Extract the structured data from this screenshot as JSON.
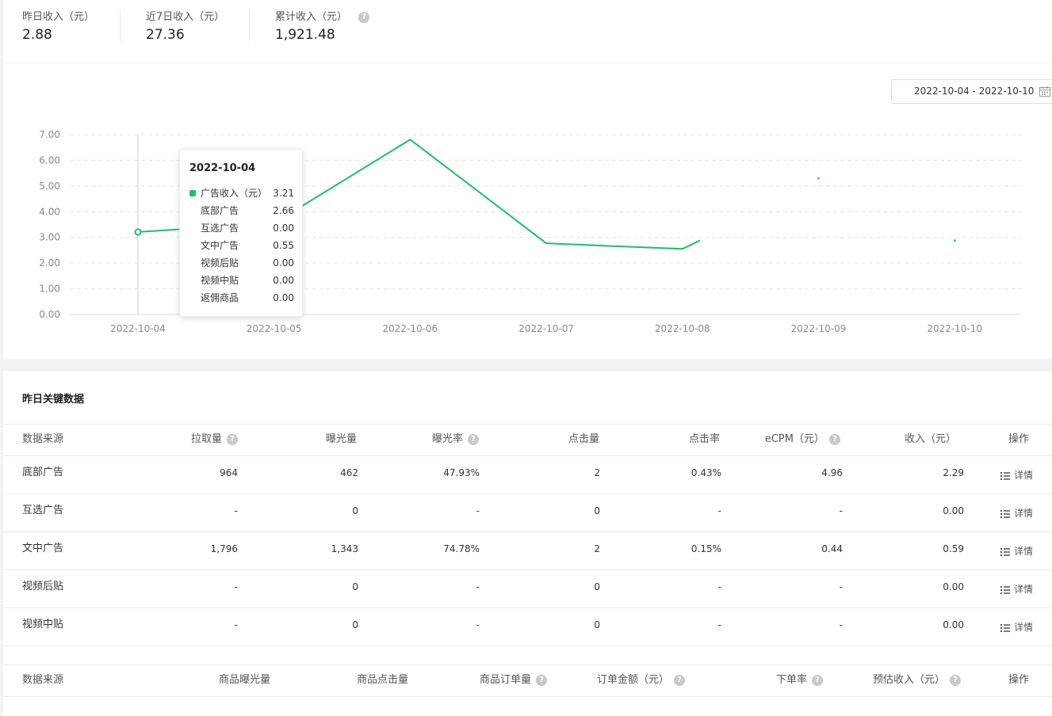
{
  "summary": {
    "yesterday_label": "昨日收入（元）",
    "yesterday_value": "2.88",
    "week_label": "近7日收入（元）",
    "week_value": "27.36",
    "total_label": "累计收入（元）",
    "total_value": "1,921.48"
  },
  "date_range": "2022-10-04 - 2022-10-10",
  "chart_data": {
    "type": "line",
    "x": [
      "2022-10-04",
      "2022-10-05",
      "2022-10-06",
      "2022-10-07",
      "2022-10-08",
      "2022-10-09",
      "2022-10-10"
    ],
    "y_ticks": [
      "0.00",
      "1.00",
      "2.00",
      "3.00",
      "4.00",
      "5.00",
      "6.00",
      "7.00"
    ],
    "ylim": [
      0,
      7
    ],
    "series": [
      {
        "values": [
          3.21,
          3.55,
          6.81,
          2.77,
          2.55,
          5.3,
          2.88
        ],
        "color": "#1dbf64"
      }
    ],
    "grid": true
  },
  "tooltip": {
    "date": "2022-10-04",
    "rows": [
      {
        "name": "广告收入（元）",
        "value": "3.21"
      },
      {
        "name": "底部广告",
        "value": "2.66"
      },
      {
        "name": "互选广告",
        "value": "0.00"
      },
      {
        "name": "文中广告",
        "value": "0.55"
      },
      {
        "name": "视频后贴",
        "value": "0.00"
      },
      {
        "name": "视频中贴",
        "value": "0.00"
      },
      {
        "name": "返佣商品",
        "value": "0.00"
      }
    ]
  },
  "table": {
    "title": "昨日关键数据",
    "headers": [
      "数据来源",
      "拉取量",
      "曝光量",
      "曝光率",
      "点击量",
      "点击率",
      "eCPM（元）",
      "收入（元）",
      "操作"
    ],
    "rows": [
      [
        "底部广告",
        "964",
        "462",
        "47.93%",
        "2",
        "0.43%",
        "4.96",
        "2.29"
      ],
      [
        "互选广告",
        "-",
        "0",
        "-",
        "0",
        "-",
        "-",
        "0.00"
      ],
      [
        "文中广告",
        "1,796",
        "1,343",
        "74.78%",
        "2",
        "0.15%",
        "0.44",
        "0.59"
      ],
      [
        "视频后贴",
        "-",
        "0",
        "-",
        "0",
        "-",
        "-",
        "0.00"
      ],
      [
        "视频中贴",
        "-",
        "0",
        "-",
        "0",
        "-",
        "-",
        "0.00"
      ]
    ],
    "detail_label": "详情",
    "headers2": [
      "数据来源",
      "商品曝光量",
      "商品点击量",
      "商品订单量",
      "订单金额（元）",
      "下单率",
      "预估收入（元）",
      "操作"
    ]
  },
  "colors": {
    "accent": "#1dbf64"
  }
}
